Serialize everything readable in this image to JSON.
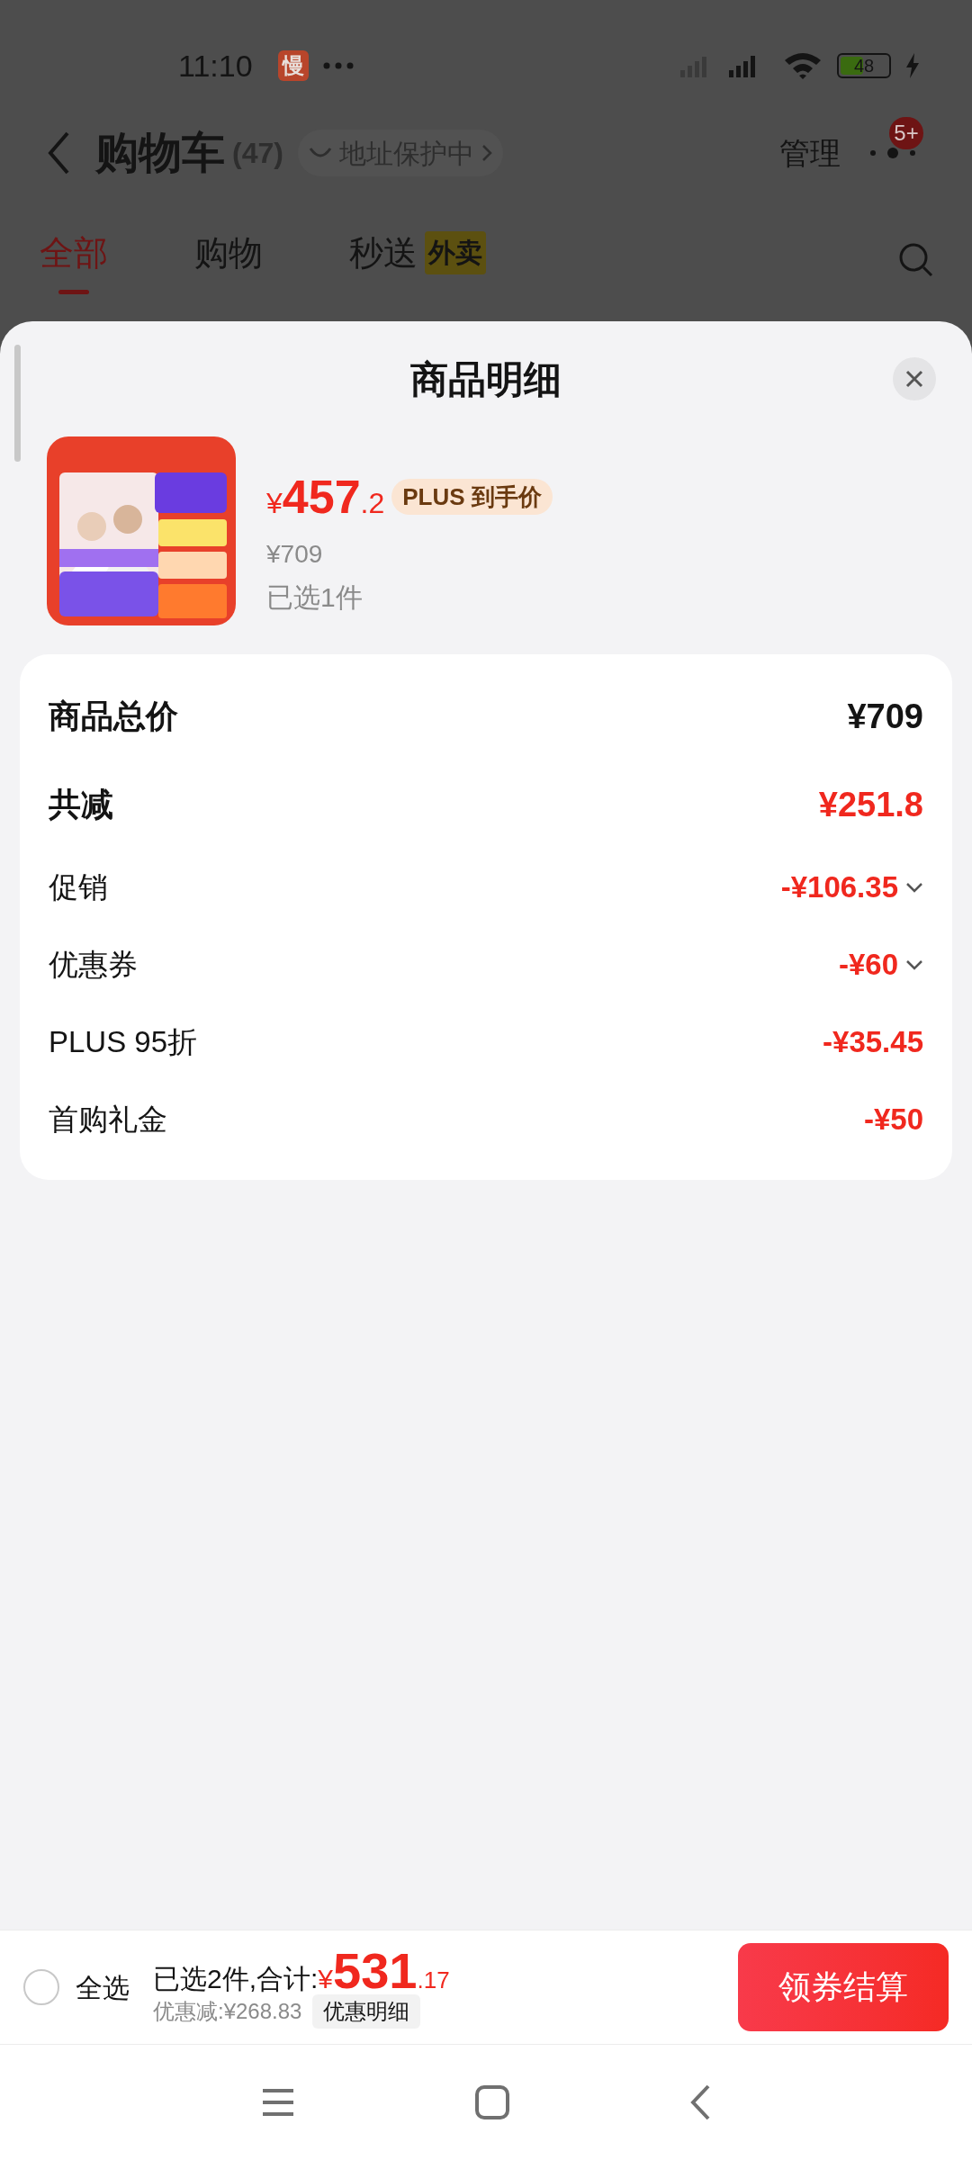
{
  "status_bar": {
    "time": "11:10",
    "app_badge": "慢",
    "battery": "48"
  },
  "header": {
    "title": "购物车",
    "count": "(47)",
    "address_chip": "地址保护中",
    "manage": "管理",
    "more_badge": "5+"
  },
  "tabs": [
    {
      "label": "全部",
      "selected": true
    },
    {
      "label": "购物",
      "selected": false
    },
    {
      "label": "秒送",
      "selected": false,
      "tag": "外卖"
    }
  ],
  "sheet": {
    "title": "商品明细",
    "product": {
      "price": {
        "symbol": "¥",
        "main": "457",
        "fraction": ".2"
      },
      "price_tag": "PLUS 到手价",
      "original_price": "¥709",
      "selected_count": "已选1件"
    },
    "summary": [
      {
        "kind": "major",
        "label": "商品总价",
        "value": "¥709",
        "highlight": false
      },
      {
        "kind": "major",
        "label": "共减",
        "value": "¥251.8",
        "highlight": true
      },
      {
        "kind": "minor",
        "label": "促销",
        "value": "-¥106.35",
        "expandable": true
      },
      {
        "kind": "minor",
        "label": "优惠券",
        "value": "-¥60",
        "expandable": true
      },
      {
        "kind": "minor",
        "label": "PLUS 95折",
        "value": "-¥35.45",
        "expandable": false
      },
      {
        "kind": "minor",
        "label": "首购礼金",
        "value": "-¥50",
        "expandable": false
      }
    ]
  },
  "checkout_bar": {
    "select_all": {
      "label": "全选",
      "checked": false
    },
    "total_label": "已选2件,合计:",
    "total": {
      "symbol": "¥",
      "main": "531",
      "fraction": ".17"
    },
    "discount": "优惠减:¥268.83",
    "detail_button": "优惠明细",
    "checkout_button": "领券结算"
  }
}
